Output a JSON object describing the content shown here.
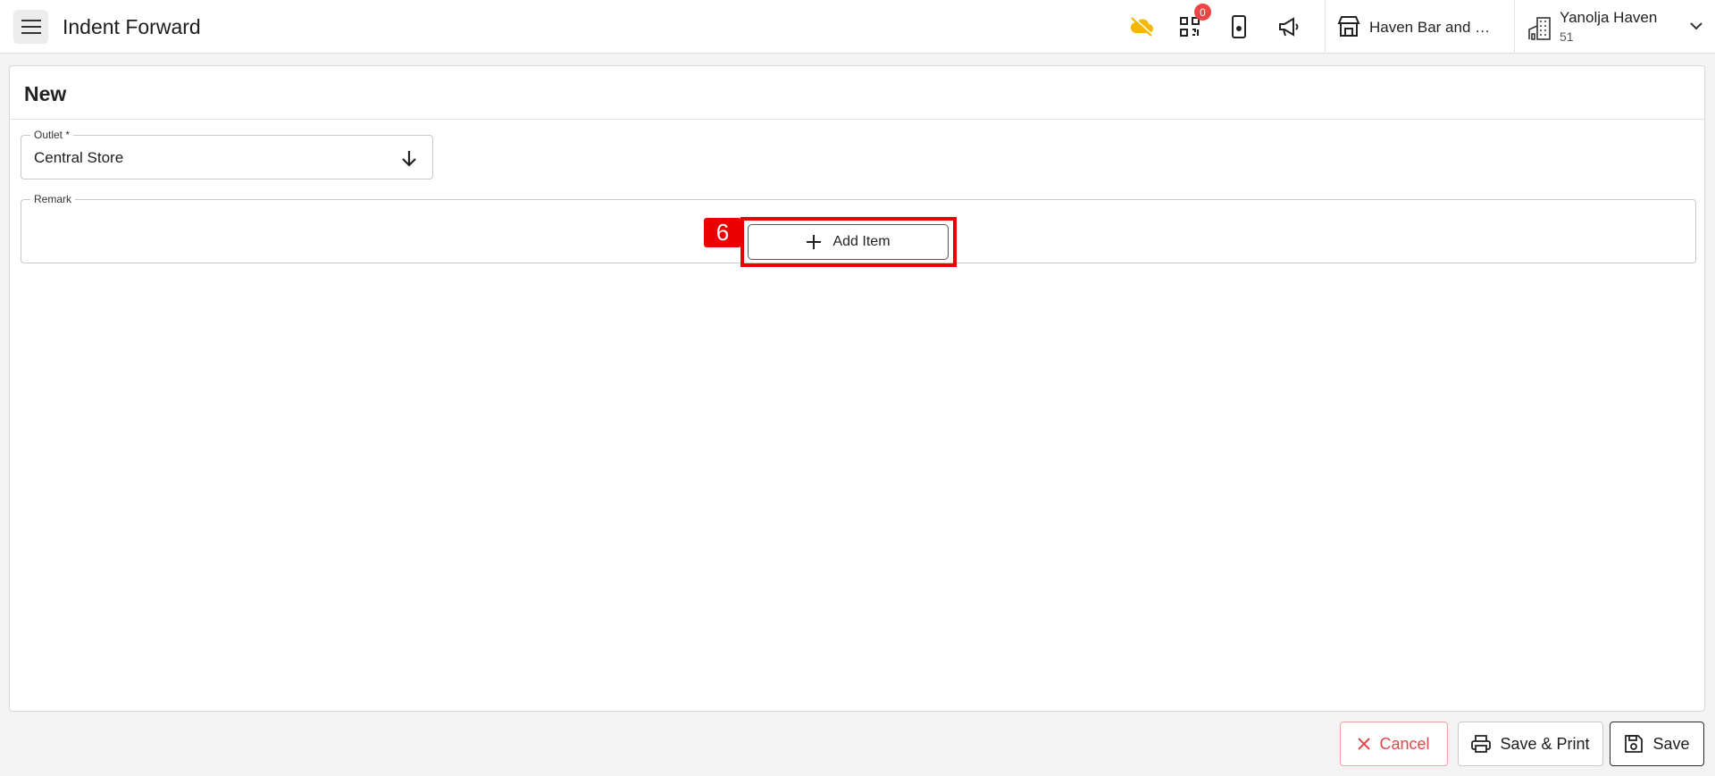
{
  "header": {
    "title": "Indent Forward",
    "qr_badge_count": "0",
    "outlet_name": "Haven Bar and Restaurant",
    "user_name": "Yanolja Haven",
    "user_sub": "51"
  },
  "form": {
    "title": "New",
    "outlet_label": "Outlet *",
    "outlet_value": "Central Store",
    "remark_label": "Remark",
    "remark_value": ""
  },
  "add_item": {
    "label": "Add Item",
    "step_number": "6"
  },
  "footer": {
    "cancel_label": "Cancel",
    "save_print_label": "Save & Print",
    "save_label": "Save"
  },
  "colors": {
    "accent_red": "#ef0000",
    "cancel_red": "#e04848",
    "cloud_yellow": "#f5b800",
    "badge_red": "#ef4444"
  },
  "icons": [
    "menu-icon",
    "cloud-off-icon",
    "qr-code-icon",
    "mobile-icon",
    "megaphone-icon",
    "store-icon",
    "building-icon",
    "chevron-down-icon",
    "arrow-down-icon",
    "plus-icon",
    "close-icon",
    "printer-icon",
    "save-icon"
  ]
}
